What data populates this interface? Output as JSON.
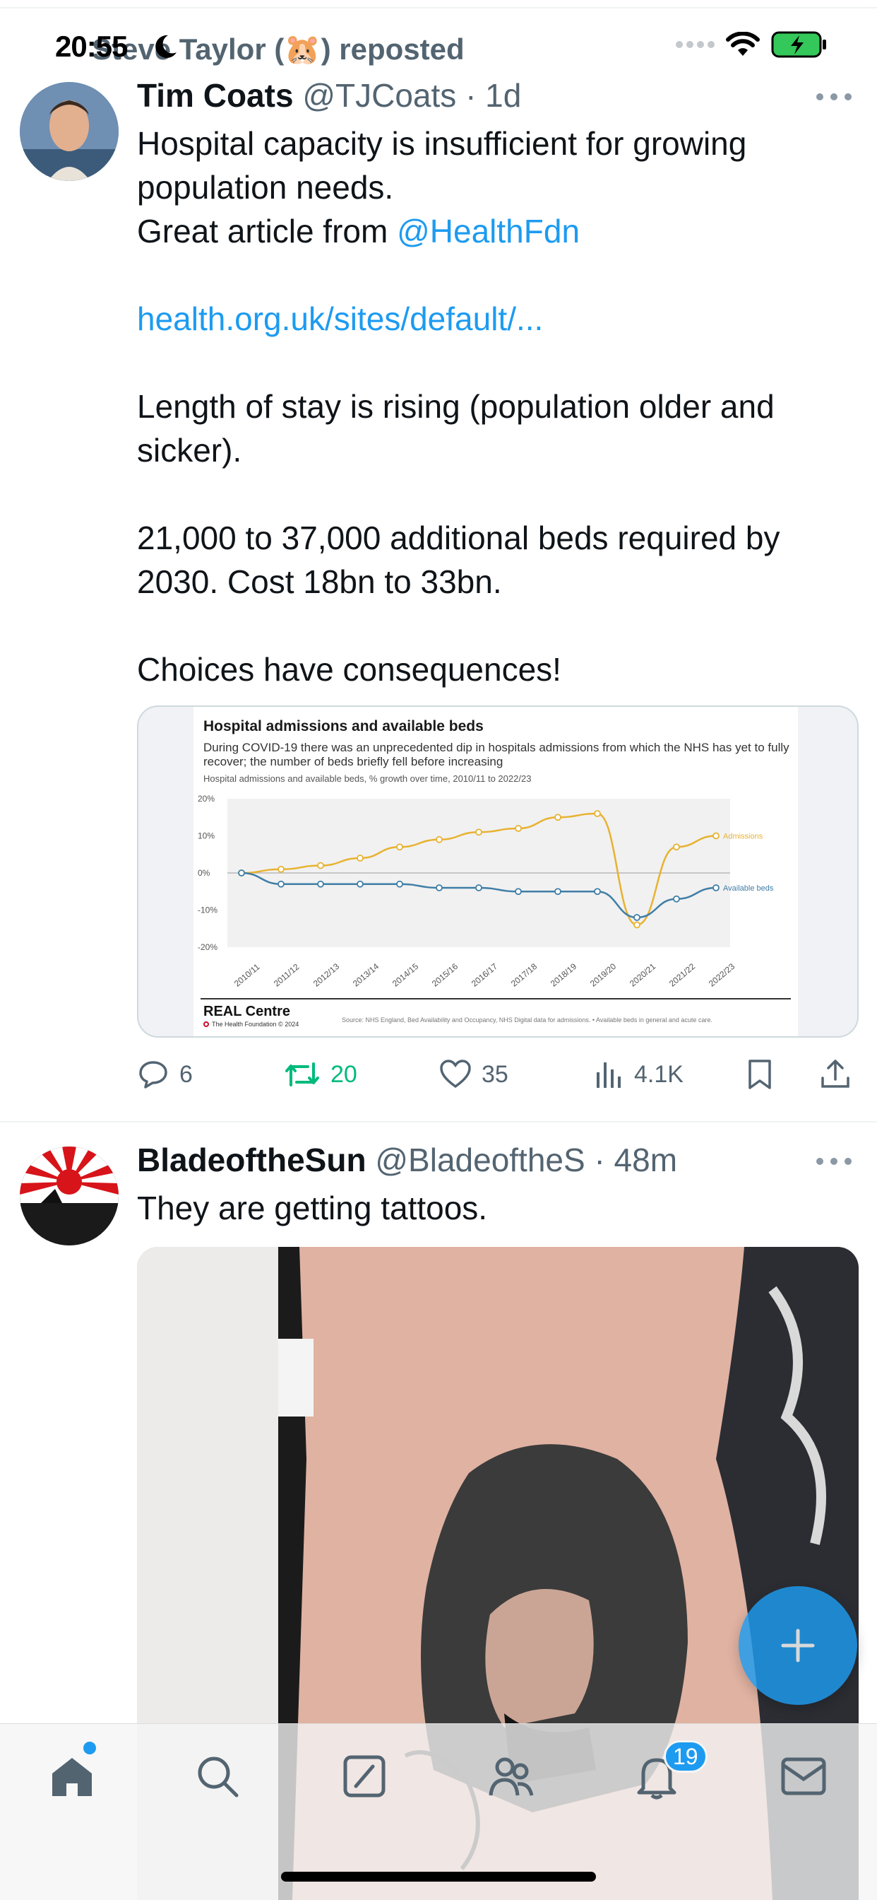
{
  "status_bar": {
    "time": "20:55"
  },
  "repost": {
    "text": "Steve Taylor (🐹) reposted"
  },
  "tweet1": {
    "author_name": "Tim Coats",
    "handle_time": "@TJCoats · 1d",
    "lines": [
      "Hospital capacity is insufficient for growing",
      "population needs.",
      "Great article from ",
      "",
      "health.org.uk/sites/default/...",
      "",
      "Length of stay is rising (population older and",
      "sicker).",
      "",
      "21,000 to 37,000 additional beds required by",
      "2030. Cost 18bn to 33bn.",
      "",
      "Choices have consequences!"
    ],
    "mention": "@HealthFdn",
    "stats": {
      "replies": "6",
      "reposts": "20",
      "likes": "35",
      "views": "4.1K"
    }
  },
  "chart_data": {
    "type": "line",
    "title": "Hospital admissions and available beds",
    "subtitle": "During COVID-19 there was an unprecedented dip in hospitals admissions from which the NHS has yet to fully recover; the number of beds briefly fell before increasing",
    "note": "Hospital admissions and available beds, % growth over time, 2010/11 to 2022/23",
    "categories": [
      "2010/11",
      "2011/12",
      "2012/13",
      "2013/14",
      "2014/15",
      "2015/16",
      "2016/17",
      "2017/18",
      "2018/19",
      "2019/20",
      "2020/21",
      "2021/22",
      "2022/23"
    ],
    "y_ticks": [
      "20%",
      "10%",
      "0%",
      "-10%",
      "-20%"
    ],
    "ylim": [
      -20,
      20
    ],
    "series": [
      {
        "name": "Admissions",
        "color": "#e8b230",
        "values": [
          0,
          1,
          2,
          4,
          7,
          9,
          11,
          12,
          15,
          16,
          -14,
          7,
          10
        ]
      },
      {
        "name": "Available beds",
        "color": "#3f7ea6",
        "values": [
          0,
          -3,
          -3,
          -3,
          -3,
          -4,
          -4,
          -5,
          -5,
          -5,
          -12,
          -7,
          -4
        ]
      }
    ],
    "brand": "REAL Centre",
    "brand_sub": "The Health Foundation © 2024",
    "source": "Source: NHS England, Bed Availability and Occupancy, NHS Digital data for admissions. • Available beds in general and acute care."
  },
  "tweet2": {
    "author_name": "BladeoftheSun",
    "handle_time": "@BladeoftheS · 48m",
    "text": "They are getting tattoos."
  },
  "nav": {
    "notifications_badge": "19"
  }
}
